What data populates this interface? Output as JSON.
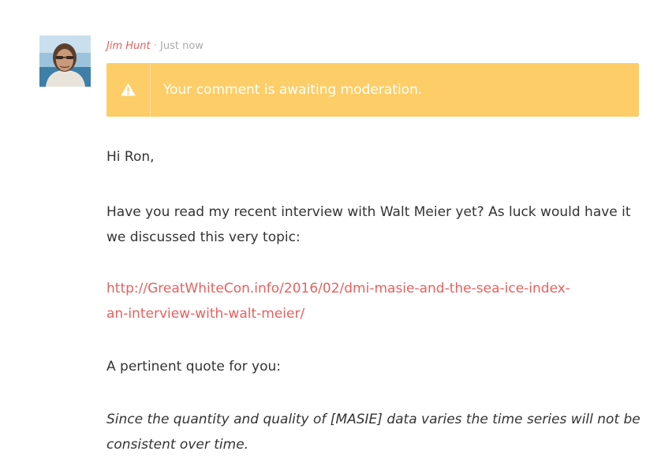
{
  "comment": {
    "author": "Jim Hunt",
    "separator": "·",
    "time": "Just now",
    "notice": {
      "icon": "warning-icon",
      "text": "Your comment is awaiting moderation.",
      "background": "#fdcd67"
    },
    "paragraphs": {
      "greeting": "Hi Ron,",
      "question": "Have you read my recent interview with Walt Meier yet? As luck would have it we discussed this very topic:",
      "link_line1": "http://GreatWhiteCon.info/2016/02/dmi-masie-and-the-sea-ice-index-",
      "link_line2": "an-interview-with-walt-meier/",
      "quote_intro": "A pertinent quote for you:",
      "quote": "Since the quantity and quality of [MASIE] data varies the time series will not be consistent over time."
    },
    "colors": {
      "link": "#e8605e",
      "text": "#333333",
      "muted": "#aaaaaa"
    }
  }
}
